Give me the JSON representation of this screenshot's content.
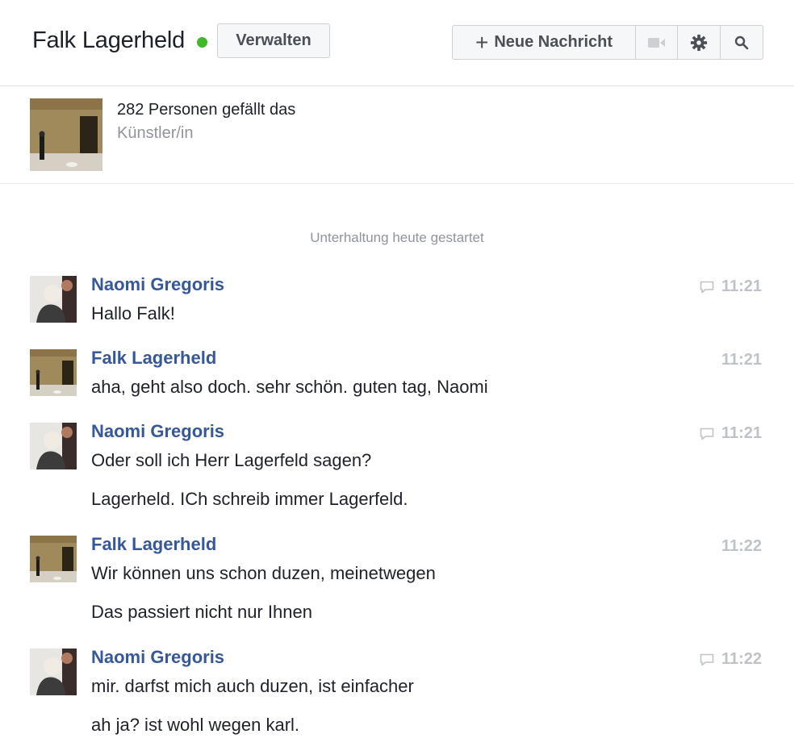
{
  "header": {
    "title": "Falk Lagerheld",
    "manage_label": "Verwalten",
    "new_message_label": "Neue Nachricht",
    "online_color": "#42b72a"
  },
  "page": {
    "likes": "282 Personen gefällt das",
    "category": "Künstler/in"
  },
  "conversation_start": "Unterhaltung heute gestartet",
  "messages": [
    {
      "sender": "Naomi Gregoris",
      "time": "11:21",
      "reply_icon": true,
      "lines": [
        "Hallo Falk!"
      ]
    },
    {
      "sender": "Falk Lagerheld",
      "time": "11:21",
      "reply_icon": false,
      "lines": [
        "aha, geht also doch. sehr schön. guten tag, Naomi"
      ]
    },
    {
      "sender": "Naomi Gregoris",
      "time": "11:21",
      "reply_icon": true,
      "lines": [
        "Oder soll ich Herr Lagerfeld sagen?",
        "Lagerheld. ICh schreib immer Lagerfeld."
      ]
    },
    {
      "sender": "Falk Lagerheld",
      "time": "11:22",
      "reply_icon": false,
      "lines": [
        "Wir können uns schon duzen, meinetwegen",
        "Das passiert nicht nur Ihnen"
      ]
    },
    {
      "sender": "Naomi Gregoris",
      "time": "11:22",
      "reply_icon": true,
      "lines": [
        "mir. darfst mich auch duzen, ist einfacher",
        "ah ja? ist wohl wegen karl."
      ]
    }
  ],
  "icons": {
    "add": "plus-icon",
    "video": "video-camera-icon",
    "settings": "gear-icon",
    "search": "search-icon",
    "reply": "speech-bubble-icon"
  }
}
